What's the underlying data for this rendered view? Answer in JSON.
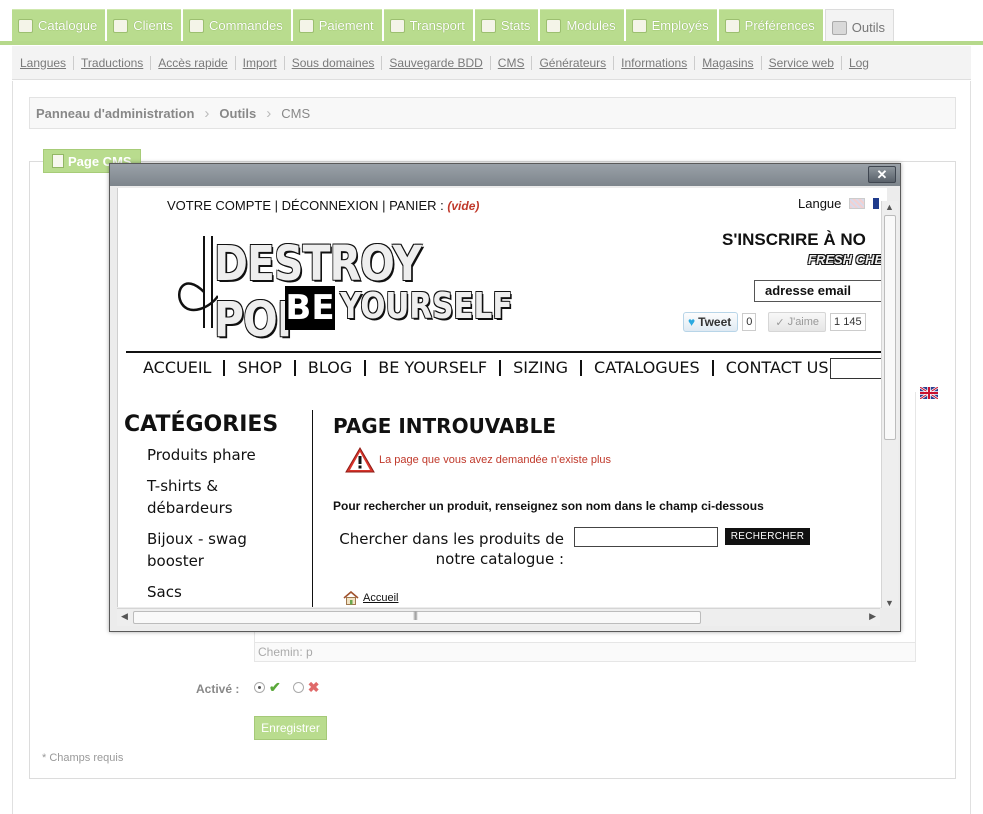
{
  "top_tabs": [
    {
      "label": "Catalogue",
      "icon": "folder-icon"
    },
    {
      "label": "Clients",
      "icon": "user-icon"
    },
    {
      "label": "Commandes",
      "icon": "orders-icon"
    },
    {
      "label": "Paiement",
      "icon": "payment-icon"
    },
    {
      "label": "Transport",
      "icon": "truck-icon"
    },
    {
      "label": "Stats",
      "icon": "stats-icon"
    },
    {
      "label": "Modules",
      "icon": "puzzle-icon"
    },
    {
      "label": "Employés",
      "icon": "employee-icon"
    },
    {
      "label": "Préférences",
      "icon": "preferences-icon"
    },
    {
      "label": "Outils",
      "icon": "wrench-icon",
      "active": true
    }
  ],
  "sub_nav": [
    "Langues",
    "Traductions",
    "Accès rapide",
    "Import",
    "Sous domaines",
    "Sauvegarde BDD",
    "CMS",
    "Générateurs",
    "Informations",
    "Magasins",
    "Service web",
    "Log"
  ],
  "breadcrumb": {
    "root": "Panneau d'administration",
    "section": "Outils",
    "page": "CMS"
  },
  "form": {
    "legend": "Page CMS",
    "path_label": "Chemin: p",
    "active_label": "Activé :",
    "save_label": "Enregistrer",
    "required_note": "* Champs requis"
  },
  "modal": {
    "close_label": "✕",
    "shop": {
      "account": "VOTRE COMPTE",
      "logout": "DÉCONNEXION",
      "cart": "PANIER :",
      "cart_empty": "(vide)",
      "language_label": "Langue",
      "logo_line1": "DESTROY POP",
      "logo_be": "BE",
      "logo_line2": "YOURSELF",
      "signup_title": "S'INSCRIRE À NO",
      "signup_sub": "FRESH CHE",
      "email_placeholder": "adresse email",
      "tweet_label": "Tweet",
      "tweet_count": "0",
      "like_label": "J'aime",
      "like_count": "1 145",
      "nav": [
        "ACCUEIL",
        "SHOP",
        "BLOG",
        "BE YOURSELF",
        "SIZING",
        "CATALOGUES",
        "CONTACT US"
      ],
      "categories_title": "CATÉGORIES",
      "categories": [
        "Produits phare",
        "T-shirts & débardeurs",
        "Bijoux - swag booster",
        "Sacs"
      ],
      "page_title": "PAGE INTROUVABLE",
      "error_message": "La page que vous avez demandée n'existe plus",
      "search_hint": "Pour rechercher un produit, renseignez son nom dans le champ ci-dessous",
      "search_label": "Chercher dans les produits de notre catalogue :",
      "search_button": "RECHERCHER",
      "home_link": "Accueil"
    }
  },
  "colors": {
    "accent_green": "#b9dc8e",
    "error_red": "#c0392b"
  }
}
